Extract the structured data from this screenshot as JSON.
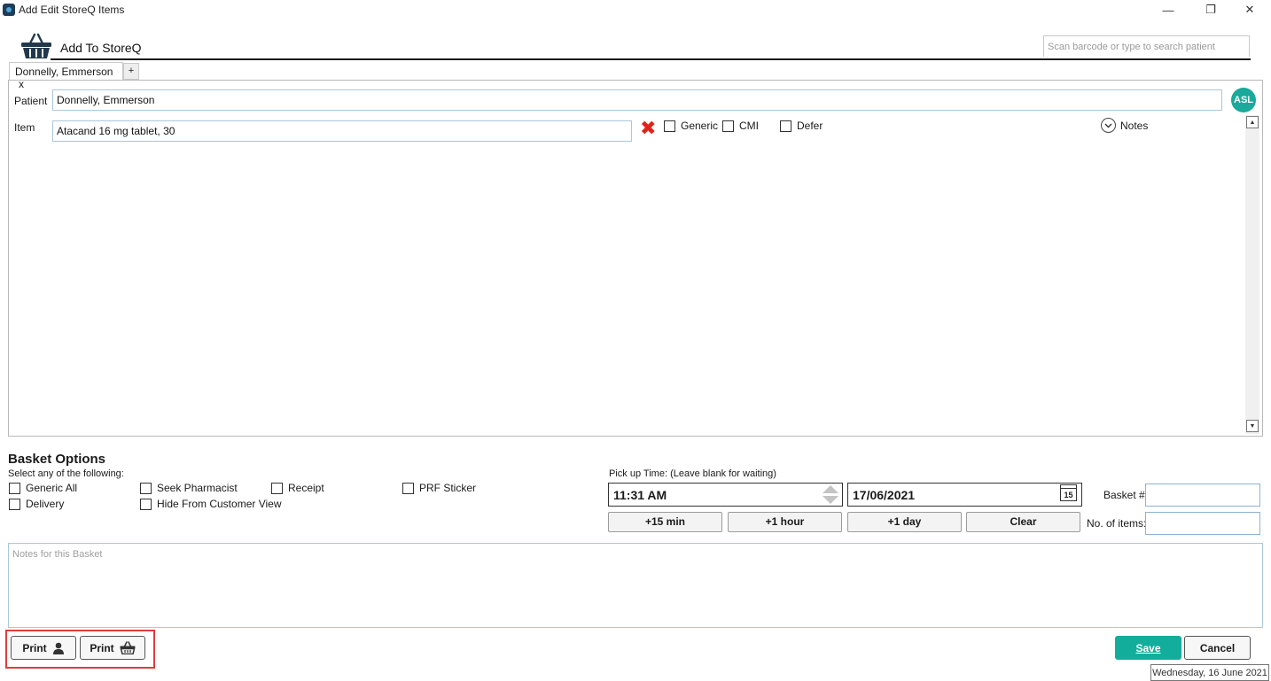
{
  "window": {
    "title": "Add Edit StoreQ Items",
    "minimize_glyph": "—",
    "restore_glyph": "❐",
    "close_glyph": "✕"
  },
  "header": {
    "title": "Add To StoreQ",
    "icon": "basket-icon",
    "search_placeholder": "Scan barcode or type to search patient"
  },
  "tabs": [
    {
      "label": "Donnelly, Emmerson",
      "close": "x"
    }
  ],
  "tab_add": "+",
  "form": {
    "patient_label": "Patient",
    "patient_value": "Donnelly, Emmerson",
    "item_label": "Item",
    "item_value": "Atacand 16 mg tablet, 30",
    "avatar_initials": "ASL",
    "remove_glyph": "✖",
    "options": [
      {
        "label": "Generic",
        "checked": false
      },
      {
        "label": "CMI",
        "checked": false
      },
      {
        "label": "Defer",
        "checked": false
      }
    ],
    "notes_label": "Notes"
  },
  "basket_options": {
    "title": "Basket Options",
    "subtitle": "Select any of the following:",
    "checkboxes": [
      {
        "label": "Generic All",
        "checked": false
      },
      {
        "label": "Seek Pharmacist",
        "checked": false
      },
      {
        "label": "Receipt",
        "checked": false
      },
      {
        "label": "PRF Sticker",
        "checked": false
      },
      {
        "label": "Delivery",
        "checked": false
      },
      {
        "label": "Hide From Customer View",
        "checked": false
      }
    ]
  },
  "pickup": {
    "label": "Pick up Time: (Leave blank for waiting)",
    "time_value": "11:31  AM",
    "date_value": "17/06/2021",
    "calendar_day": "15",
    "buttons": [
      "+15 min",
      "+1 hour",
      "+1 day",
      "Clear"
    ],
    "basket_number_label": "Basket #:",
    "items_count_label": "No. of items:"
  },
  "notes_placeholder": "Notes for this Basket",
  "footer": {
    "print_patient_label": "Print",
    "print_basket_label": "Print",
    "save_label": "Save",
    "cancel_label": "Cancel",
    "date_tooltip": "Wednesday, 16 June 2021"
  },
  "colors": {
    "accent": "#13ad9b",
    "avatar": "#1aa99a",
    "highlight": "#e03c3c",
    "remove": "#e0241b"
  }
}
